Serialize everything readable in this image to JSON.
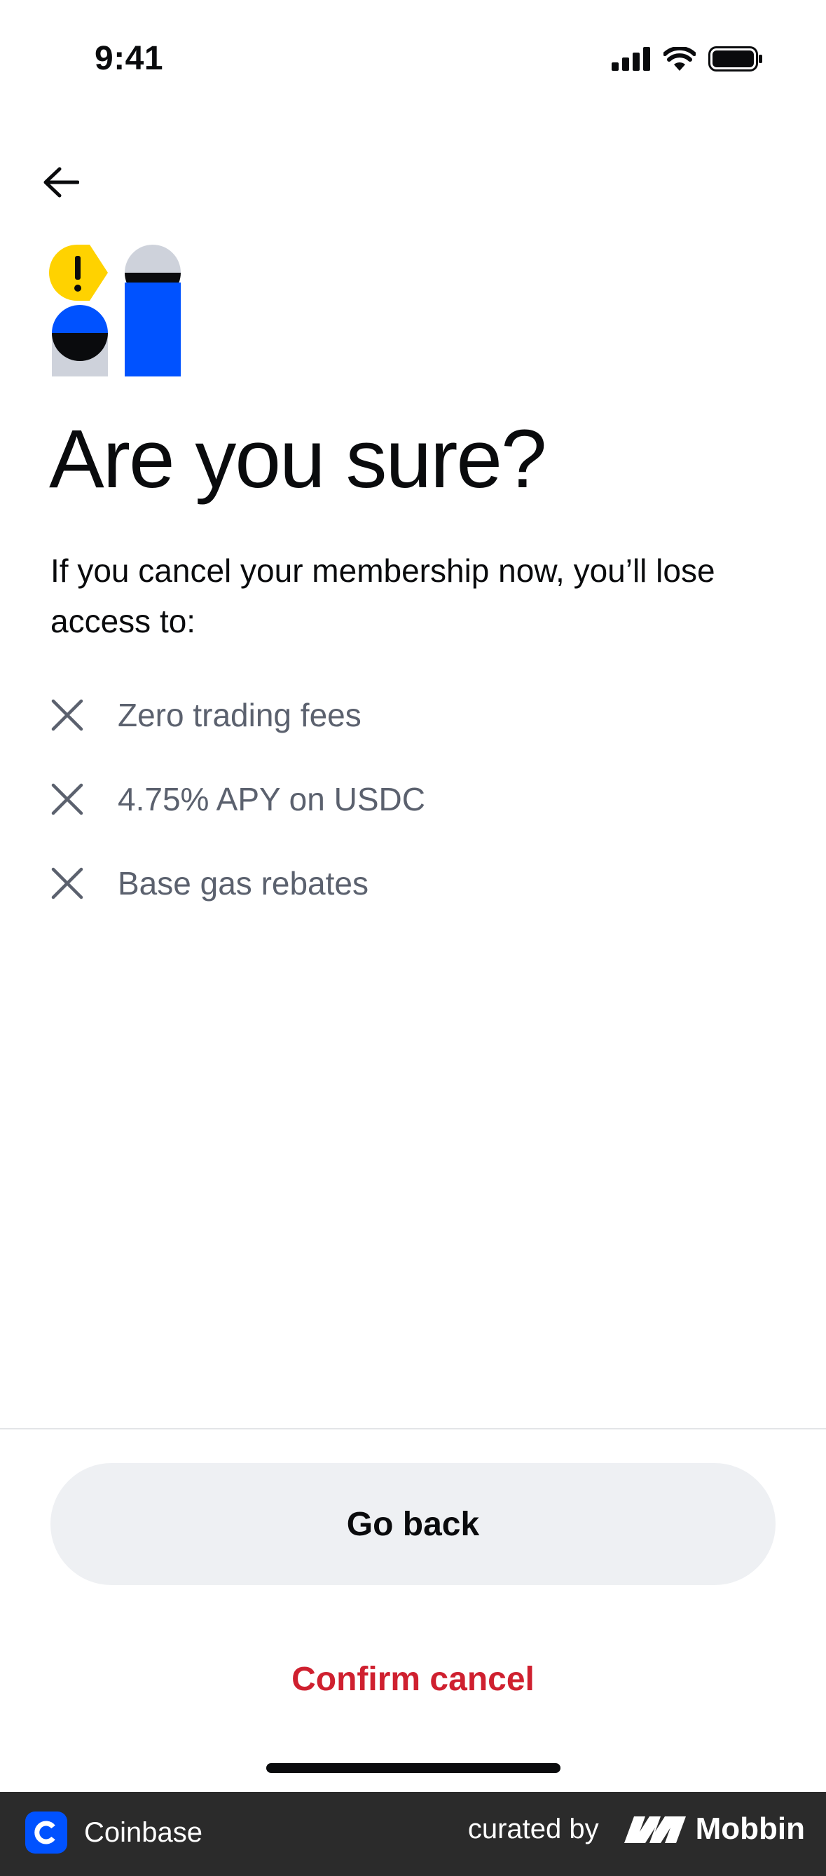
{
  "status_bar": {
    "time": "9:41"
  },
  "screen": {
    "title": "Are you sure?",
    "description": "If you cancel your membership now, you’ll lose access to:",
    "benefits": [
      "Zero trading fees",
      "4.75% APY on USDC",
      "Base gas rebates"
    ]
  },
  "actions": {
    "go_back_label": "Go back",
    "confirm_label": "Confirm cancel"
  },
  "footer": {
    "app_name": "Coinbase",
    "curated_by": "curated by",
    "brand": "Mobbin"
  },
  "colors": {
    "accent_blue": "#0052ff",
    "warning_yellow": "#ffd200",
    "danger_red": "#cf202f",
    "secondary_bg": "#eef0f3",
    "muted_text": "#5b616e"
  },
  "icons": [
    "back-arrow-icon",
    "warning-illustration",
    "close-x-icon",
    "signal-icon",
    "wifi-icon",
    "battery-icon",
    "coinbase-logo-icon",
    "mobbin-logo-icon"
  ]
}
